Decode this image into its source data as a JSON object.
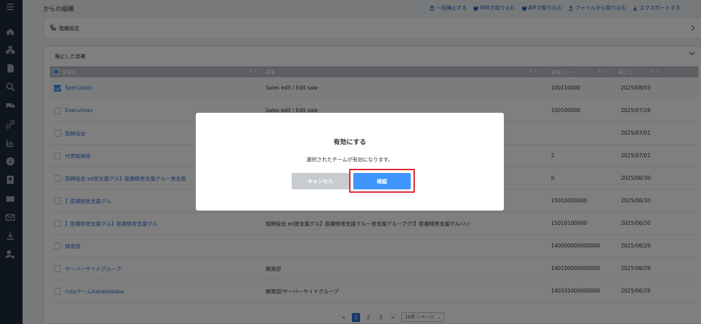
{
  "header": {
    "title": "からの組織",
    "actions": [
      {
        "label": "一括廃止する",
        "icon": "trash-icon"
      },
      {
        "label": "RPAで取り込む",
        "icon": "plug-icon"
      },
      {
        "label": "APIで取り込む",
        "icon": "plug-icon"
      },
      {
        "label": "ファイルから取り込む",
        "icon": "upload-icon"
      },
      {
        "label": "エクスポートする",
        "icon": "download-icon"
      }
    ]
  },
  "settings": {
    "label": "階層設定"
  },
  "section": {
    "title": "廃止した部署"
  },
  "table": {
    "columns": [
      "部署名",
      "部署",
      "部署コード",
      "廃止日"
    ],
    "rows": [
      {
        "name": "Specialists",
        "dept": "Sales edit / Edit sale",
        "code": "100110000",
        "date": "2025/08/03",
        "checked": true
      },
      {
        "name": "Executives",
        "dept": "Sales edit / Edit sale",
        "code": "100100000",
        "date": "2025/07/28",
        "checked": false
      },
      {
        "name": "取締役会",
        "dept": "",
        "code": "",
        "date": "2025/07/01",
        "checked": false
      },
      {
        "name": "代表取締役",
        "dept": "",
        "code": "2",
        "date": "2025/07/01",
        "checked": false
      },
      {
        "name": "取締役会 ed営支援グル】医療経営支援グルー営支援",
        "dept": "",
        "code": "0",
        "date": "2025/06/30",
        "checked": false
      },
      {
        "name": "】医療経営支援グル",
        "dept": "",
        "code": "15010000000",
        "date": "2025/06/30",
        "checked": false
      },
      {
        "name": "】医療経営支援グル】医療経営支援グル",
        "dept": "取締役会 ed営支援グル】医療経営支援グルー営支援グループグ/】医療経営支援グル/-/-/-",
        "code": "15010100000",
        "date": "2025/06/30",
        "checked": false
      },
      {
        "name": "開発部",
        "dept": "",
        "code": "140000000000000",
        "date": "2025/06/29",
        "checked": false
      },
      {
        "name": "サーバーサイドグループ",
        "dept": "開発部",
        "code": "140100000000000",
        "date": "2025/06/29",
        "checked": false
      },
      {
        "name": "rubyチームbababababa",
        "dept": "開発部/サーバーサイドグループ",
        "code": "140101000000000",
        "date": "2025/06/29",
        "checked": false
      }
    ]
  },
  "pagination": {
    "prev": "<",
    "pages": [
      "1",
      "2",
      "3"
    ],
    "next": ">",
    "page_size": "10件 / ページ",
    "current": "1"
  },
  "modal": {
    "title": "有効にする",
    "message": "選択されたチームが有効になります。",
    "cancel_label": "キャンセル",
    "confirm_label": "確認"
  },
  "colors": {
    "accent": "#4096ff",
    "highlight": "#e0232b",
    "sidebar": "#1f2a3a",
    "link": "#2f6fd1"
  }
}
